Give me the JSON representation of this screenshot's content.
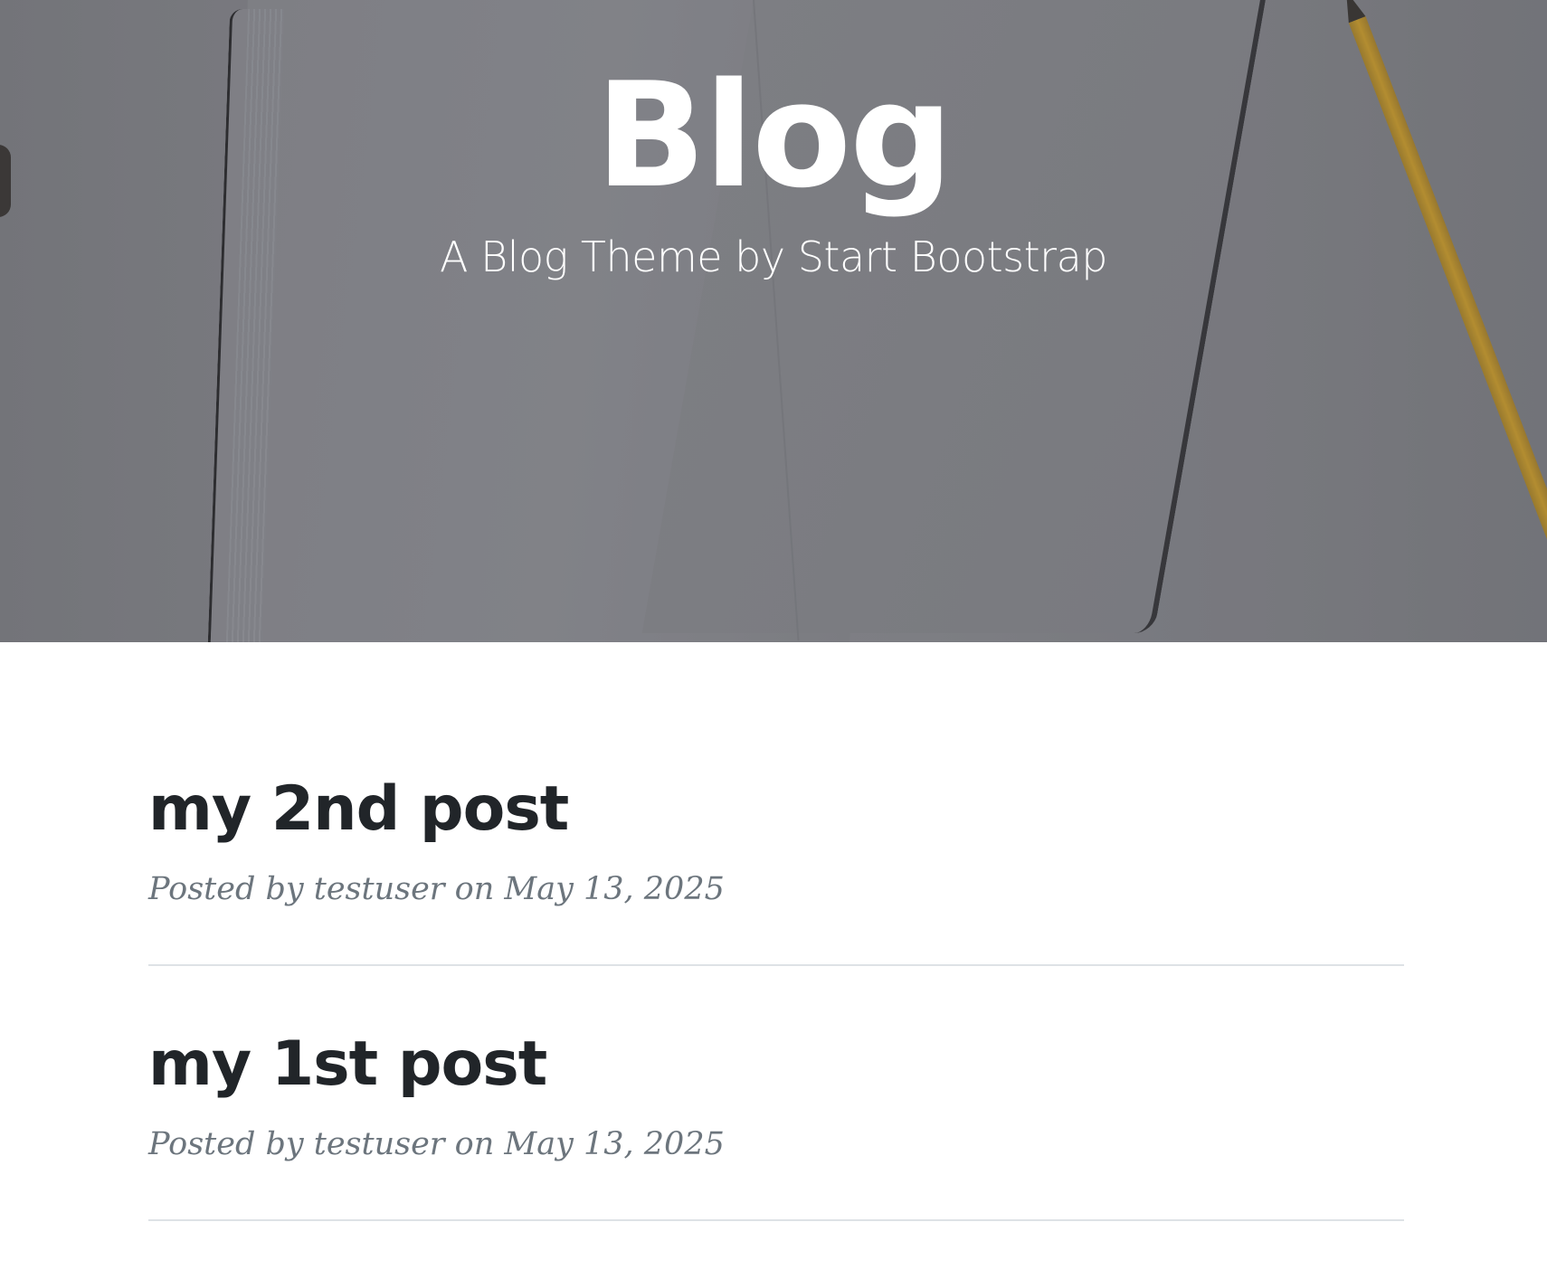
{
  "masthead": {
    "title": "Blog",
    "subtitle": "A Blog Theme by Start Bootstrap"
  },
  "posts": [
    {
      "title": "my 2nd post",
      "meta": "Posted by testuser on May 13, 2025"
    },
    {
      "title": "my 1st post",
      "meta": "Posted by testuser on May 13, 2025"
    }
  ],
  "colors": {
    "heading_text": "#212529",
    "meta_text": "#6c757d",
    "divider": "#dee2e6",
    "hero_text": "#ffffff"
  }
}
